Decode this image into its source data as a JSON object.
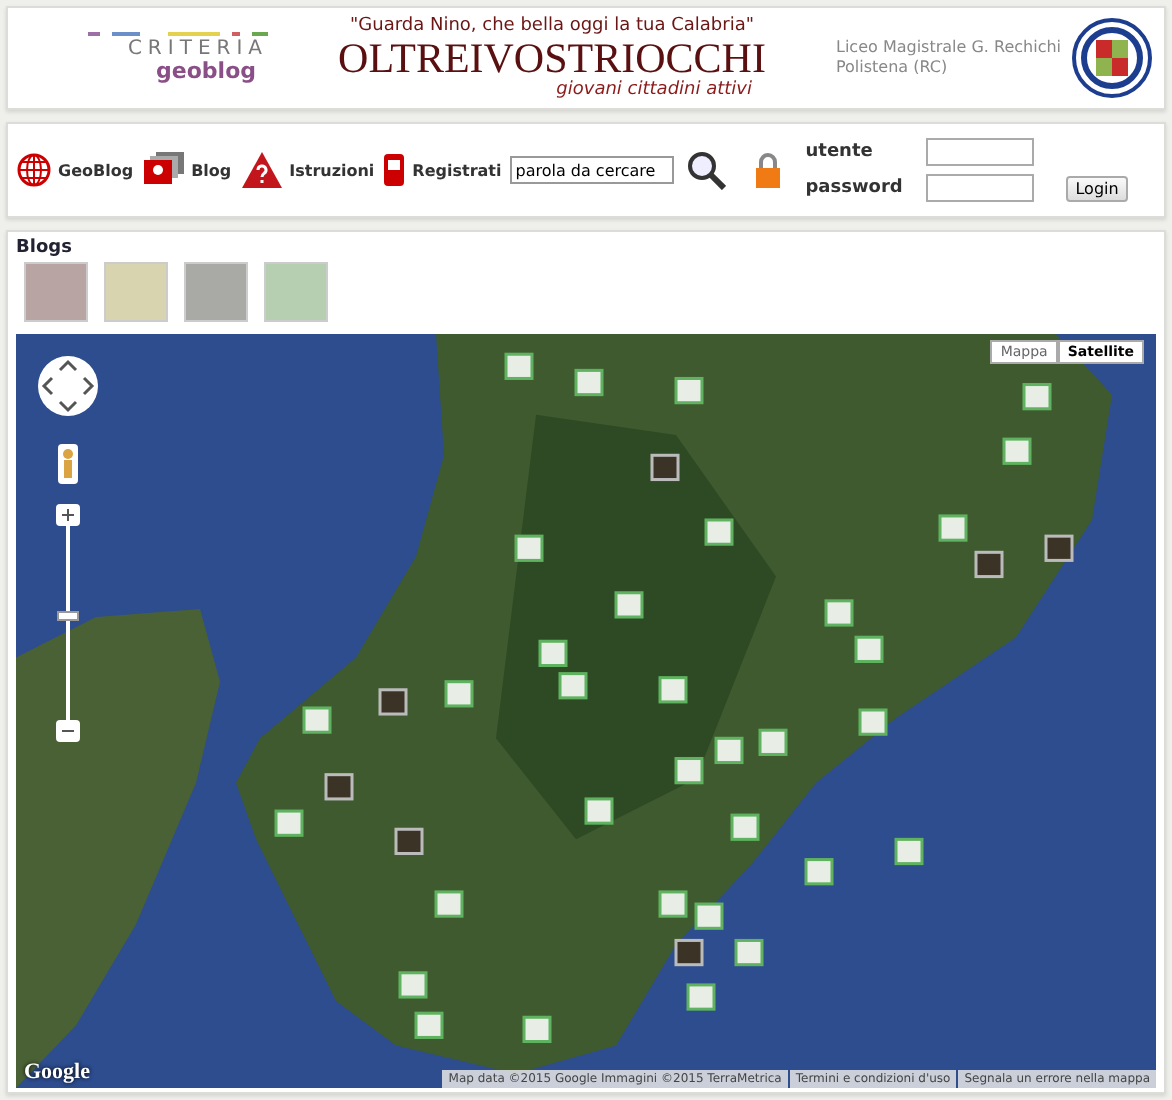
{
  "header": {
    "logo": {
      "line1": "CRITERIA",
      "line2": "geoblog"
    },
    "quote": "\"Guarda Nino, che bella oggi la tua Calabria\"",
    "title": "OLTREIVOSTRIOCCHI",
    "subtitle": "giovani cittadini attivi",
    "school": [
      "Liceo Magistrale G. Rechichi",
      "Polistena (RC)"
    ]
  },
  "nav": {
    "links": [
      {
        "label": "GeoBlog",
        "kind": "globe"
      },
      {
        "label": "Blog",
        "kind": "blog"
      },
      {
        "label": "Istruzioni",
        "kind": "warning"
      },
      {
        "label": "Registrati",
        "kind": "phone"
      }
    ],
    "search": {
      "value": "parola da cercare"
    },
    "login": {
      "user_label": "utente",
      "password_label": "password",
      "button": "Login"
    }
  },
  "blogs": {
    "title": "Blogs",
    "thumbnails": [
      {
        "color": "#b8a4a2"
      },
      {
        "color": "#d9d4b0"
      },
      {
        "color": "#a9a9a6"
      },
      {
        "color": "#b5cfb0"
      }
    ]
  },
  "map": {
    "type_buttons": [
      {
        "label": "Mappa",
        "selected": false
      },
      {
        "label": "Satellite",
        "selected": true
      }
    ],
    "logo": "Google",
    "attribution": [
      "Map data ©2015 Google Immagini ©2015 TerraMetrica",
      "Termini e condizioni d'uso",
      "Segnala un errore nella mappa"
    ]
  }
}
